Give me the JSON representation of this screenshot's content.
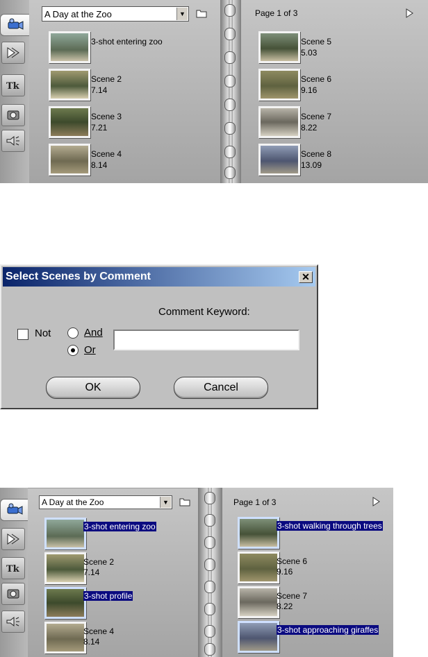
{
  "album_top": {
    "project_dropdown": "A Day at the Zoo",
    "page_label": "Page 1 of 3",
    "left_scenes": [
      {
        "name": "3-shot entering zoo",
        "length": ""
      },
      {
        "name": "Scene 2",
        "length": "7.14"
      },
      {
        "name": "Scene 3",
        "length": "7.21"
      },
      {
        "name": "Scene 4",
        "length": "8.14"
      }
    ],
    "right_scenes": [
      {
        "name": "Scene 5",
        "length": "5.03"
      },
      {
        "name": "Scene 6",
        "length": "9.16"
      },
      {
        "name": "Scene 7",
        "length": "8.22"
      },
      {
        "name": "Scene 8",
        "length": "13.09"
      }
    ]
  },
  "dialog": {
    "title": "Select Scenes by Comment",
    "close_glyph": "✕",
    "comment_keyword_label": "Comment Keyword:",
    "not_label": "Not",
    "and_label": "And",
    "or_label": "Or",
    "keyword_value": "",
    "ok_label": "OK",
    "cancel_label": "Cancel",
    "not_checked": false,
    "selected_operator": "Or"
  },
  "album_bottom": {
    "project_dropdown": "A Day at the Zoo",
    "page_label": "Page 1 of 3",
    "left_scenes": [
      {
        "name": "3-shot entering zoo",
        "length": "",
        "selected": true
      },
      {
        "name": "Scene 2",
        "length": "7.14",
        "selected": false
      },
      {
        "name": "3-shot profile",
        "length": "",
        "selected": true
      },
      {
        "name": "Scene 4",
        "length": "8.14",
        "selected": false
      }
    ],
    "right_scenes": [
      {
        "name": "3-shot walking through trees",
        "length": "",
        "selected": true
      },
      {
        "name": "Scene 6",
        "length": "9.16",
        "selected": false
      },
      {
        "name": "Scene 7",
        "length": "8.22",
        "selected": false
      },
      {
        "name": "3-shot approaching giraffes",
        "length": "",
        "selected": true
      }
    ]
  },
  "tab_icons": [
    "camcorder-icon",
    "transitions-icon",
    "titles-icon",
    "still-images-icon",
    "sound-effects-icon"
  ],
  "colors": {
    "selection": "#0a0a80",
    "dialog_title_start": "#0a246a",
    "dialog_title_end": "#a6caf0"
  }
}
